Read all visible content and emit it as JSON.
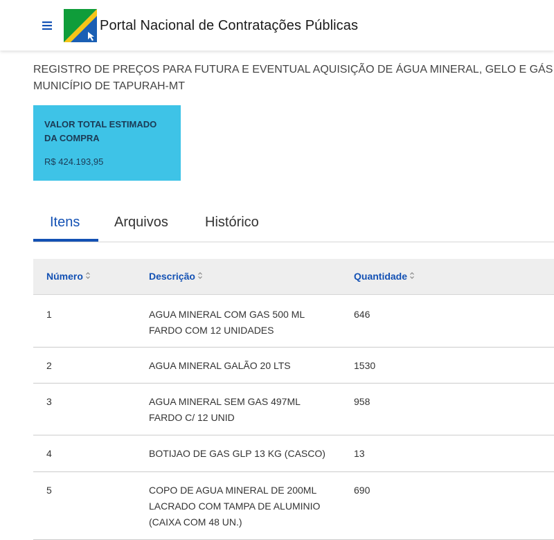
{
  "header": {
    "title": "Portal Nacional de Contratações Públicas",
    "menu_icon": "hamburger-menu-icon",
    "logo_icon": "pncp-logo"
  },
  "purchase": {
    "description": "REGISTRO DE PREÇOS PARA FUTURA E EVENTUAL AQUISIÇÃO DE ÁGUA MINERAL, GELO E GÁS DO MUNICÍPIO DE TAPURAH-MT",
    "total_label": "VALOR TOTAL ESTIMADO DA COMPRA",
    "total_value": "R$ 424.193,95"
  },
  "tabs": [
    {
      "label": "Itens",
      "active": true
    },
    {
      "label": "Arquivos",
      "active": false
    },
    {
      "label": "Histórico",
      "active": false
    }
  ],
  "table": {
    "columns": [
      "Número",
      "Descrição",
      "Quantidade"
    ],
    "rows": [
      {
        "numero": "1",
        "descricao": "AGUA MINERAL COM GAS 500 ML FARDO COM 12 UNIDADES",
        "quantidade": "646"
      },
      {
        "numero": "2",
        "descricao": "AGUA MINERAL GALÃO 20 LTS",
        "quantidade": "1530"
      },
      {
        "numero": "3",
        "descricao": "AGUA MINERAL SEM GAS 497ML FARDO C/ 12 UNID",
        "quantidade": "958"
      },
      {
        "numero": "4",
        "descricao": "BOTIJAO DE GAS GLP 13 KG (CASCO)",
        "quantidade": "13"
      },
      {
        "numero": "5",
        "descricao": "COPO DE AGUA MINERAL DE 200ML LACRADO COM TAMPA DE ALUMINIO (CAIXA COM 48 UN.)",
        "quantidade": "690"
      }
    ]
  },
  "colors": {
    "primary_blue": "#1351b4",
    "card_background": "#3ec3e7",
    "card_text": "#1b3a55",
    "table_header_bg": "#eeeeee"
  }
}
